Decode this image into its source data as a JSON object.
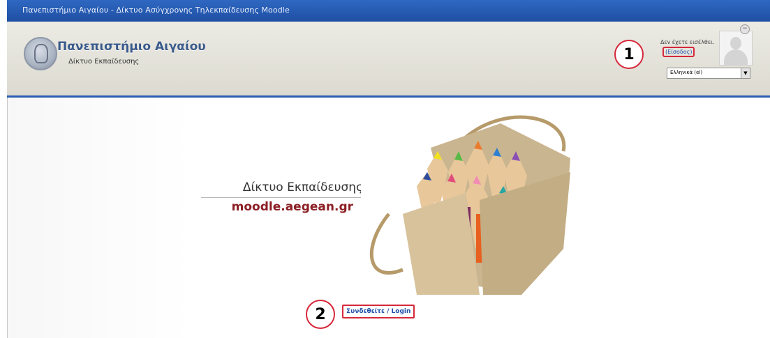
{
  "window": {
    "title": "Πανεπιστήμιο Αιγαίου - Δίκτυο Ασύγχρονης Τηλεκπαίδευσης Moodle"
  },
  "header": {
    "logo_title": "Πανεπιστήμιο Αιγαίου",
    "logo_subtitle": "Δίκτυο Εκπαίδευσης",
    "login_status": "Δεν έχετε εισέλθει.",
    "login_link": "(Είσοδος)",
    "language_selected": "Ελληνικά (el)"
  },
  "annotations": {
    "step1": "1",
    "step2": "2"
  },
  "banner": {
    "title": "Δίκτυο Εκπαίδευσης",
    "url": "moodle.aegean.gr"
  },
  "main": {
    "login_button": "Συνδεθείτε / Login"
  },
  "colors": {
    "titlebar": "#2559b5",
    "accent": "#2a5cb3",
    "annotation": "#d6283b",
    "url_text": "#8c1f25"
  }
}
